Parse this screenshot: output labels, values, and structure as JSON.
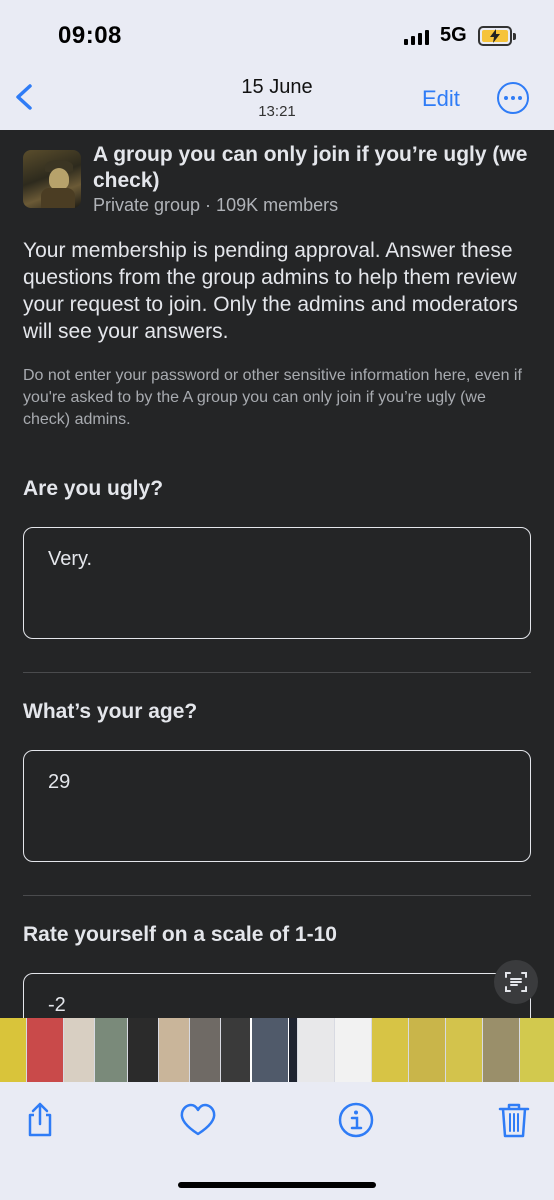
{
  "status_bar": {
    "time": "09:08",
    "network": "5G"
  },
  "nav": {
    "date": "15 June",
    "time": "13:21",
    "edit_label": "Edit",
    "accent_color": "#2f7cf6"
  },
  "group": {
    "name": "A group you can only join if you’re ugly (we check)",
    "meta": "Private group · 109K members"
  },
  "pending_message": "Your membership is pending approval. Answer these questions from the group admins to help them review your request to join. Only the admins and moderators will see your answers.",
  "warning_message": "Do not enter your password or other sensitive information here, even if you're asked to by the A group you can only join if you’re ugly (we check) admins.",
  "questions": [
    {
      "question": "Are you ugly?",
      "answer": "Very."
    },
    {
      "question": "What’s your age?",
      "answer": "29"
    },
    {
      "question": "Rate yourself on a scale of 1-10",
      "answer": "-2"
    }
  ],
  "icons": {
    "back": "chevron-left-icon",
    "more": "ellipsis-circle-icon",
    "live_text": "live-text-icon",
    "share": "share-icon",
    "favorite": "heart-icon",
    "info": "info-icon",
    "delete": "trash-icon"
  },
  "thumbnails": [
    "#d9c43a",
    "#c94a4a",
    "#d8cfc2",
    "#7a8a7a",
    "#2b2b2b",
    "#c9b59a",
    "#6f6a65",
    "#3a3a3a",
    "#505a6a",
    "#1f2430",
    "#e8e8ea",
    "#f2f2f2",
    "#d7c445",
    "#c9b54a",
    "#d3c34c",
    "#9a8f6a",
    "#d2c94e",
    "#c4b653"
  ]
}
